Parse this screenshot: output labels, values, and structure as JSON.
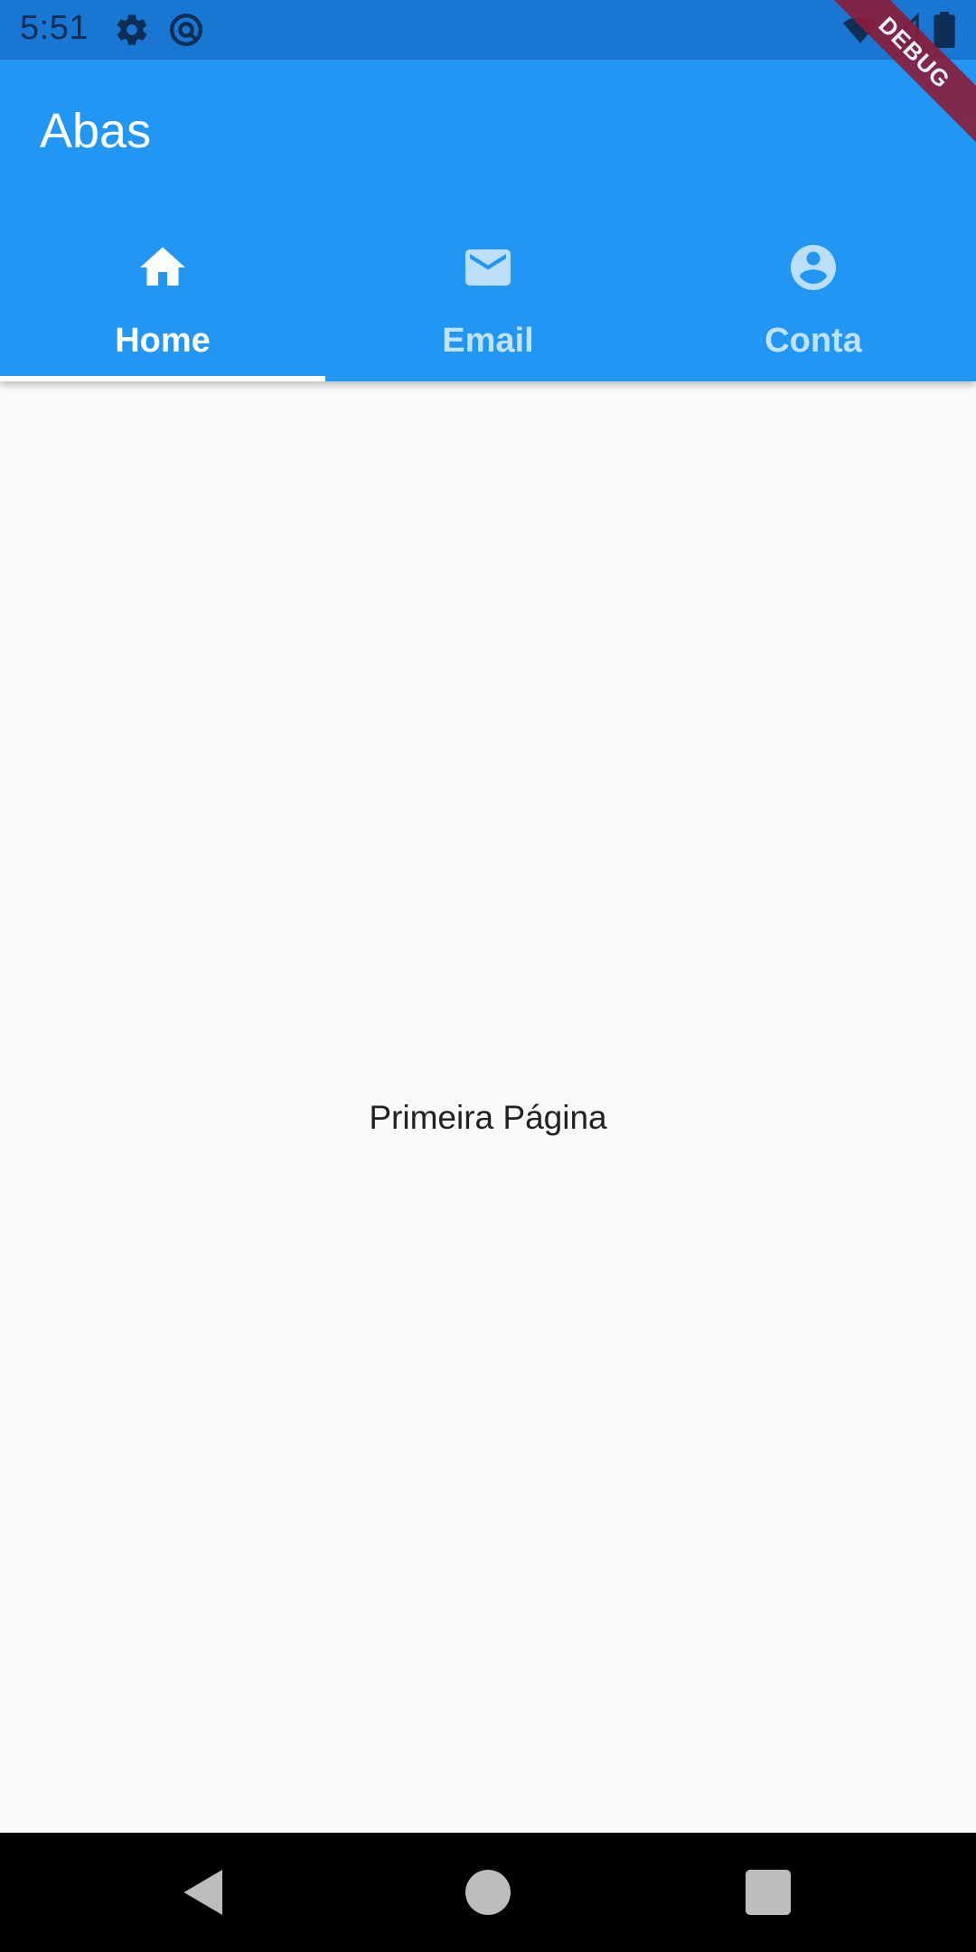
{
  "status_bar": {
    "time": "5:51",
    "icons": [
      "settings-icon",
      "at-sign-icon",
      "wifi-icon",
      "signal-icon",
      "battery-icon"
    ]
  },
  "app_bar": {
    "title": "Abas",
    "background_color": "#2196f3"
  },
  "tabs": [
    {
      "label": "Home",
      "icon": "home-icon",
      "selected": true
    },
    {
      "label": "Email",
      "icon": "email-icon",
      "selected": false
    },
    {
      "label": "Conta",
      "icon": "account-circle-icon",
      "selected": false
    }
  ],
  "page": {
    "text": "Primeira Página"
  },
  "debug_banner": {
    "label": "DEBUG"
  },
  "nav_bar": {
    "buttons": [
      "back-icon",
      "home-circle-icon",
      "recents-icon"
    ]
  }
}
